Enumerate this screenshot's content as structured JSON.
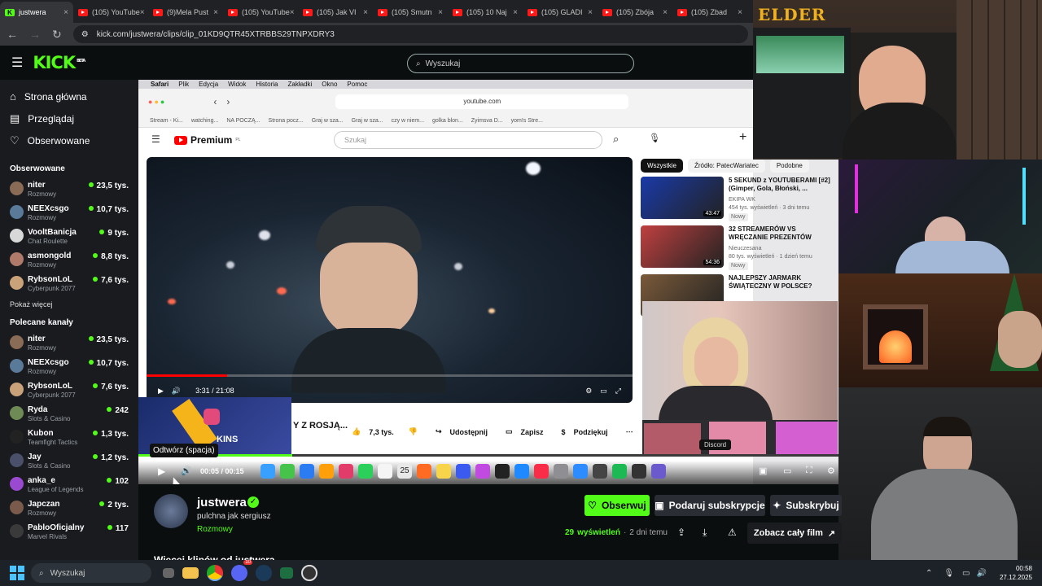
{
  "browser": {
    "tabs": [
      {
        "label": "justwera",
        "active": true
      },
      {
        "label": "(105) YouTube"
      },
      {
        "label": "(9)Mela Pust"
      },
      {
        "label": "(105) YouTube"
      },
      {
        "label": "(105) Jak VI"
      },
      {
        "label": "(105) Smutn"
      },
      {
        "label": "(105) 10 Naj"
      },
      {
        "label": "(105) GLADI"
      },
      {
        "label": "(105) Zbója"
      },
      {
        "label": "(105) Zbad"
      }
    ],
    "url": "kick.com/justwera/clips/clip_01KD9QTR45XTRBBS29TNPXDRY3"
  },
  "kick": {
    "logo": "KICK",
    "logo_badge": "BETA",
    "search_placeholder": "Wyszukaj",
    "nav": [
      {
        "label": "Strona główna",
        "icon": "home-icon"
      },
      {
        "label": "Przeglądaj",
        "icon": "browse-icon"
      },
      {
        "label": "Obserwowane",
        "icon": "heart-icon"
      }
    ],
    "followed_title": "Obserwowane",
    "followed": [
      {
        "name": "niter",
        "game": "Rozmowy",
        "viewers": "23,5 tys.",
        "color": "#8a6b55"
      },
      {
        "name": "NEEXcsgo",
        "game": "Rozmowy",
        "viewers": "10,7 tys.",
        "color": "#5a7a9a"
      },
      {
        "name": "VooltBanicja",
        "game": "Chat Roulette",
        "viewers": "9 tys.",
        "color": "#d8d8d8"
      },
      {
        "name": "asmongold",
        "game": "Rozmowy",
        "viewers": "8,8 tys.",
        "color": "#b07a6a"
      },
      {
        "name": "RybsonLoL",
        "game": "Cyberpunk 2077",
        "viewers": "7,6 tys.",
        "color": "#c9a27a"
      }
    ],
    "show_more": "Pokaż więcej",
    "recommended_title": "Polecane kanały",
    "recommended": [
      {
        "name": "niter",
        "game": "Rozmowy",
        "viewers": "23,5 tys.",
        "color": "#8a6b55"
      },
      {
        "name": "NEEXcsgo",
        "game": "Rozmowy",
        "viewers": "10,7 tys.",
        "color": "#5a7a9a"
      },
      {
        "name": "RybsonLoL",
        "game": "Cyberpunk 2077",
        "viewers": "7,6 tys.",
        "color": "#c9a27a"
      },
      {
        "name": "Ryda",
        "game": "Slots & Casino",
        "viewers": "242",
        "color": "#6f8b55"
      },
      {
        "name": "Kubon",
        "game": "Teamfight Tactics",
        "viewers": "1,3 tys.",
        "color": "#222222"
      },
      {
        "name": "Jay",
        "game": "Slots & Casino",
        "viewers": "1,2 tys.",
        "color": "#4a4f6a"
      },
      {
        "name": "anka_e",
        "game": "League of Legends",
        "viewers": "102",
        "color": "#9a4ad0"
      },
      {
        "name": "Japczan",
        "game": "Rozmowy",
        "viewers": "2 tys.",
        "color": "#7a5a4a"
      },
      {
        "name": "PabloOficjalny",
        "game": "Marvel Rivals",
        "viewers": "117",
        "color": "#3a3a3a"
      }
    ],
    "channel": {
      "name": "justwera",
      "title": "pulchna jak sergiusz",
      "category": "Rozmowy",
      "views_count": "29",
      "views_label": "wyświetleń",
      "age": "2 dni temu",
      "follow": "Obserwuj",
      "gift": "Podaruj subskrypcje",
      "subscribe": "Subskrybuj",
      "full_video": "Zobacz cały film",
      "more_clips": "Więcej klipów od justwera"
    },
    "clip_player": {
      "tooltip": "Odtwórz (spacja)",
      "time": "00:05 / 00:15",
      "progress": 0.22
    }
  },
  "clip_content": {
    "mac_menu": [
      "Safari",
      "Plik",
      "Edycja",
      "Widok",
      "Historia",
      "Zakładki",
      "Okno",
      "Pomoc"
    ],
    "safari_url": "youtube.com",
    "bookmarks": [
      "Stream - Ki...",
      "watching...",
      "NA POCZĄ...",
      "Strona pocz...",
      "Graj w sza...",
      "Graj w sza...",
      "czy w niem...",
      "golka blon...",
      "Zyimsva D...",
      "yom!s Stre..."
    ],
    "yt_brand": "Premium",
    "yt_region": "PL",
    "yt_search": "Szukaj",
    "yt_time": "3:31 / 21:08",
    "yt_progress": 0.166,
    "yt_title_fragment": "Y Z ROSJĄ...",
    "overlay_text": "KINS",
    "yt_actions": {
      "likes": "7,3 tys.",
      "share": "Udostępnij",
      "save": "Zapisz",
      "thanks": "Podziękuj"
    },
    "chips": [
      "Wszystkie",
      "Źródło: PatecWariatec",
      "Podobne"
    ],
    "suggestions": [
      {
        "title": "5 SEKUND z YOUTUBERAMI [#2] (Gimper, Gola, Błoński, ...",
        "meta1": "EKIPA WK",
        "meta2": "454 tys. wyświetleń · 3 dni temu",
        "badge": "Nowy",
        "duration": "43:47",
        "color": "#1a3aa8"
      },
      {
        "title": "32 STREAMERÓW VS WRĘCZANIE PREZENTÓW",
        "meta1": "Nieuczesana",
        "meta2": "80 tys. wyświetleń · 1 dzień temu",
        "badge": "Nowy",
        "duration": "54:36",
        "color": "#c04040"
      },
      {
        "title": "NAJLEPSZY JARMARK ŚWIĄTECZNY W POLSCE?",
        "meta1": "",
        "meta2": "",
        "badge": "",
        "duration": "",
        "color": "#7a5a3a"
      }
    ],
    "discord_label": "Discord",
    "cal_day": "25",
    "streamer_logo": "ELDER"
  },
  "taskbar": {
    "search": "Wyszukaj",
    "time": "00:58",
    "date": "27.12.2025",
    "discord_badge": "10"
  }
}
